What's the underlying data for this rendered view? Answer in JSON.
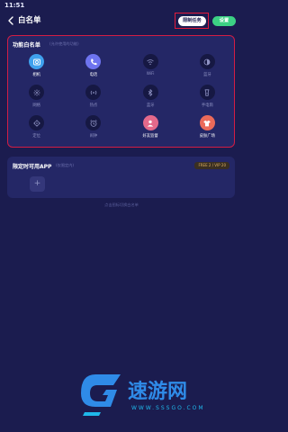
{
  "status": {
    "time": "11:51"
  },
  "header": {
    "title": "白名单",
    "allow_button": "限制任务",
    "confirm_button": "设置"
  },
  "function_section": {
    "title": "功能白名单",
    "hint": "(允许使用的功能)",
    "items": [
      {
        "label": "相机",
        "icon": "camera-icon",
        "active": "active-blue"
      },
      {
        "label": "电话",
        "icon": "phone-icon",
        "active": "active-purple"
      },
      {
        "label": "WiFi",
        "icon": "wifi-icon",
        "active": ""
      },
      {
        "label": "蓝牙",
        "icon": "moon-icon",
        "active": ""
      },
      {
        "label": "网络",
        "icon": "network-icon",
        "active": ""
      },
      {
        "label": "热点",
        "icon": "hotspot-icon",
        "active": ""
      },
      {
        "label": "蓝牙",
        "icon": "bluetooth-icon",
        "active": ""
      },
      {
        "label": "手电筒",
        "icon": "flashlight-icon",
        "active": ""
      },
      {
        "label": "定位",
        "icon": "location-icon",
        "active": ""
      },
      {
        "label": "闹钟",
        "icon": "alarm-icon",
        "active": ""
      },
      {
        "label": "好友监督",
        "icon": "friend-icon",
        "active": "active-pink"
      },
      {
        "label": "皮肤广场",
        "icon": "skin-icon",
        "active": "active-orange"
      }
    ]
  },
  "apps_section": {
    "title": "限定时可用APP",
    "hint": "(仅限定内)",
    "badge": "FREE 2 / VIP 20",
    "add_label": "+"
  },
  "footer_note": "点击图标切换白名单",
  "watermark": {
    "brand": "速游网",
    "url": "www.sssgo.com",
    "colors": {
      "primary": "#2f8be8",
      "secondary": "#1fb8ea"
    }
  }
}
